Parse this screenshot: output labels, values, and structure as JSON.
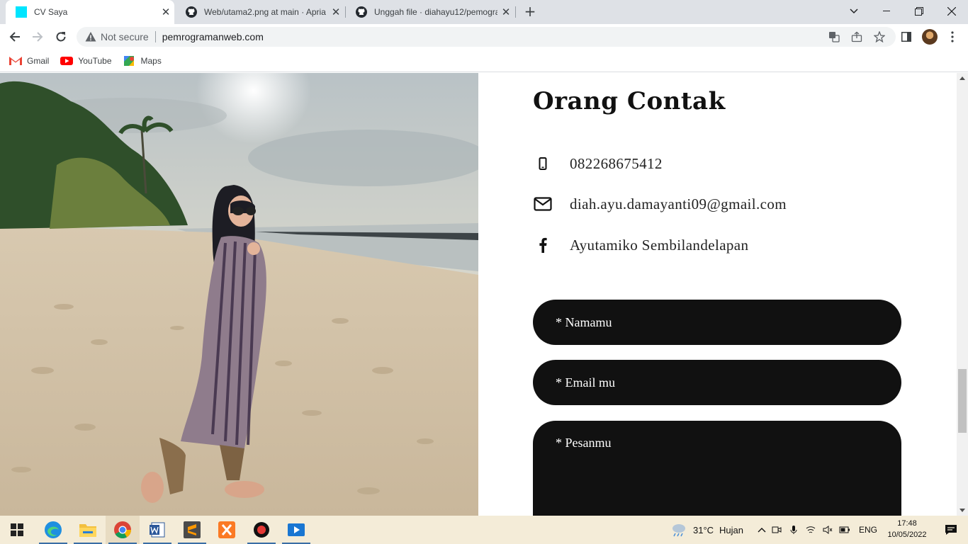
{
  "browser": {
    "tabs": [
      {
        "title": "CV Saya",
        "active": true
      },
      {
        "title": "Web/utama2.png at main · Apria",
        "active": false
      },
      {
        "title": "Unggah file · diahayu12/pemogra",
        "active": false
      }
    ],
    "address": {
      "security_label": "Not secure",
      "url": "pemrogramanweb.com"
    },
    "bookmarks": [
      {
        "label": "Gmail",
        "icon": "gmail-icon"
      },
      {
        "label": "YouTube",
        "icon": "youtube-icon"
      },
      {
        "label": "Maps",
        "icon": "maps-icon"
      }
    ]
  },
  "contact": {
    "heading": "Orang Contak",
    "phone": "082268675412",
    "email": "diah.ayu.damayanti09@gmail.com",
    "facebook": "Ayutamiko Sembilandelapan"
  },
  "form": {
    "name_placeholder": "* Namamu",
    "email_placeholder": "* Email mu",
    "message_placeholder": "* Pesanmu"
  },
  "taskbar": {
    "weather": {
      "temp": "31°C",
      "condition": "Hujan"
    },
    "language": "ENG",
    "time": "17:48",
    "date": "10/05/2022"
  },
  "colors": {
    "tab_favicon": "#00e5ff",
    "form_field_bg": "#111111",
    "taskbar_bg": "#f4ecd8"
  }
}
